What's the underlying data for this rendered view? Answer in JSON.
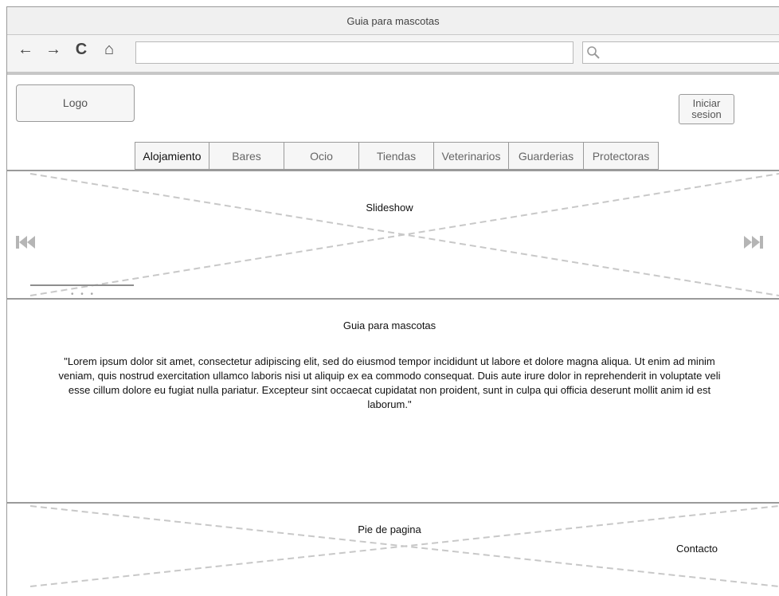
{
  "browser": {
    "title": "Guia para mascotas",
    "nav": {
      "back": "←",
      "forward": "→",
      "reload": "C",
      "home": "⌂"
    },
    "search": {
      "placeholder": ""
    }
  },
  "header": {
    "logo": "Logo",
    "login": "Iniciar\nsesion",
    "tabs": [
      "Alojamiento",
      "Bares",
      "Ocio",
      "Tiendas",
      "Veterinarios",
      "Guarderias",
      "Protectoras"
    ]
  },
  "slideshow": {
    "label": "Slideshow",
    "dots": "• • •"
  },
  "content": {
    "title": "Guia para mascotas",
    "text": "\"Lorem ipsum dolor sit amet, consectetur adipiscing elit, sed do eiusmod tempor incididunt ut labore et dolore magna aliqua. Ut enim ad minim\nveniam, quis nostrud exercitation ullamco laboris nisi ut aliquip ex ea commodo consequat. Duis aute irure dolor in reprehenderit in voluptate veli\nesse cillum dolore eu fugiat nulla pariatur. Excepteur sint occaecat cupidatat non proident, sunt in culpa qui officia deserunt mollit anim id est\nlaborum.\""
  },
  "footer": {
    "title": "Pie de pagina",
    "contact": "Contacto"
  }
}
